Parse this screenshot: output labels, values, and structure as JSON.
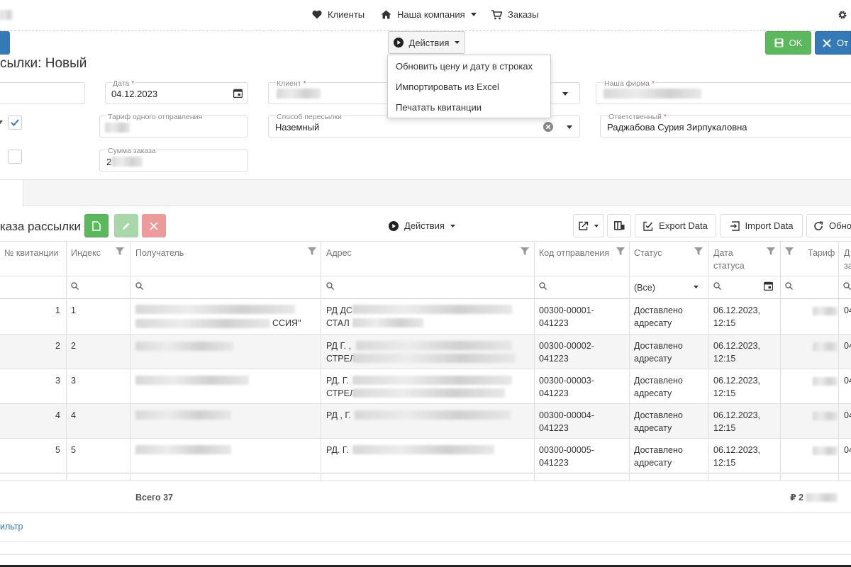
{
  "nav": {
    "clients": "Клиенты",
    "company": "Наша компания",
    "orders": "Заказы"
  },
  "toolbar": {
    "actions": "Действия",
    "ok": "OK",
    "cancel_partial": "От"
  },
  "actions_menu": {
    "items": [
      "Обновить цену и дату в строках",
      "Импортировать из Excel",
      "Печатать квитанции"
    ]
  },
  "form": {
    "title": "сылки: Новый",
    "date_label": "Дата",
    "date_value": "04.12.2023",
    "client_label": "Клиент",
    "our_firm_label": "Наша фирма",
    "tariff_label": "Тариф одного отправления",
    "shipping_label": "Способ пересылки",
    "shipping_value": "Наземный",
    "responsible_label": "Ответственный",
    "responsible_value": "Раджабова Сурия Зирпукаловна",
    "sum_label": "Сумма заказа",
    "sum_value_partial": "2",
    "required_mark": "*"
  },
  "grid_toolbar": {
    "title": "каза рассылки",
    "actions": "Действия",
    "export": "Export Data",
    "import": "Import Data",
    "refresh_partial": "Обно"
  },
  "grid": {
    "columns": [
      "№ квитанции",
      "Индекс",
      "Получатель",
      "Адрес",
      "Код отправления",
      "Статус",
      "Дата статуса",
      "Тариф",
      "Д за"
    ],
    "status_filter": "(Все)",
    "rows": [
      {
        "num": "1",
        "index": "1",
        "recipient_suffix": "ССИЯ\"",
        "address_prefix": "РД ДС",
        "address_line2": "СТАЛ",
        "code": "00300-00001-041223",
        "status": "Доставлено адресату",
        "date": "06.12.2023, 12:15",
        "extra": "04"
      },
      {
        "num": "2",
        "index": "2",
        "recipient_suffix": "",
        "address_prefix": "РД Г. ,",
        "address_line2": "СТРЕЛ",
        "code": "00300-00002-041223",
        "status": "Доставлено адресату",
        "date": "06.12.2023, 12:15",
        "extra": "04"
      },
      {
        "num": "3",
        "index": "3",
        "recipient_suffix": "",
        "address_prefix": "РД. Г.",
        "address_line2": "СТРЕЛ",
        "code": "00300-00003-041223",
        "status": "Доставлено адресату",
        "date": "06.12.2023, 12:15",
        "extra": "04"
      },
      {
        "num": "4",
        "index": "4",
        "recipient_suffix": "",
        "address_prefix": "РД , Г.",
        "address_line2": "",
        "code": "00300-00004-041223",
        "status": "Доставлено адресату",
        "date": "06.12.2023, 12:15",
        "extra": "04"
      },
      {
        "num": "5",
        "index": "5",
        "recipient_suffix": "",
        "address_prefix": "РД. Г.",
        "address_line2": "",
        "code": "00300-00005-041223",
        "status": "Доставлено адресату",
        "date": "06.12.2023, 12:15",
        "extra": "04"
      }
    ],
    "total_label": "Всего 37",
    "total_sum_prefix": "₽ 2",
    "filter_link": "ильтр"
  },
  "colors": {
    "green": "#5cb85c",
    "blue": "#337ab7",
    "red_light": "#ec9a9a",
    "green_light": "#a8d8a8"
  }
}
